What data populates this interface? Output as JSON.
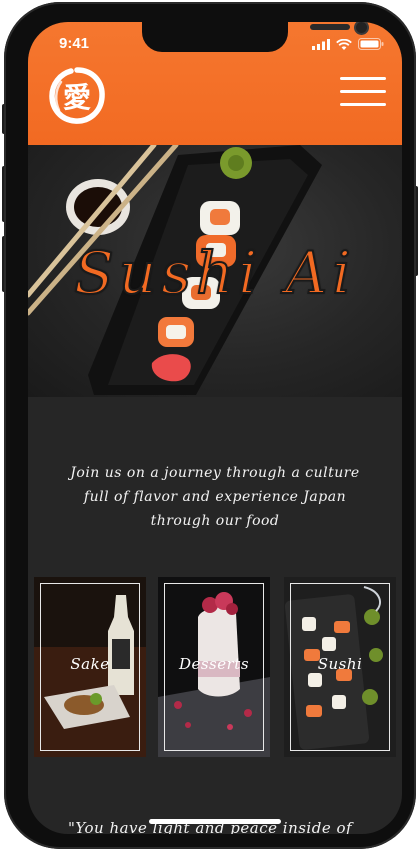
{
  "status_bar": {
    "time": "9:41"
  },
  "header": {
    "logo_glyph": "愛"
  },
  "hero": {
    "title": "Sushi Ai"
  },
  "tagline": "Join us on a journey through a culture full of flavor and experience Japan through our food",
  "cards": [
    {
      "label": "Sake"
    },
    {
      "label": "Desserts"
    },
    {
      "label": "Sushi"
    }
  ],
  "quote": "\"You have light and peace inside of",
  "colors": {
    "accent": "#f26a22",
    "background": "#262626",
    "text": "#f2f2f2"
  }
}
